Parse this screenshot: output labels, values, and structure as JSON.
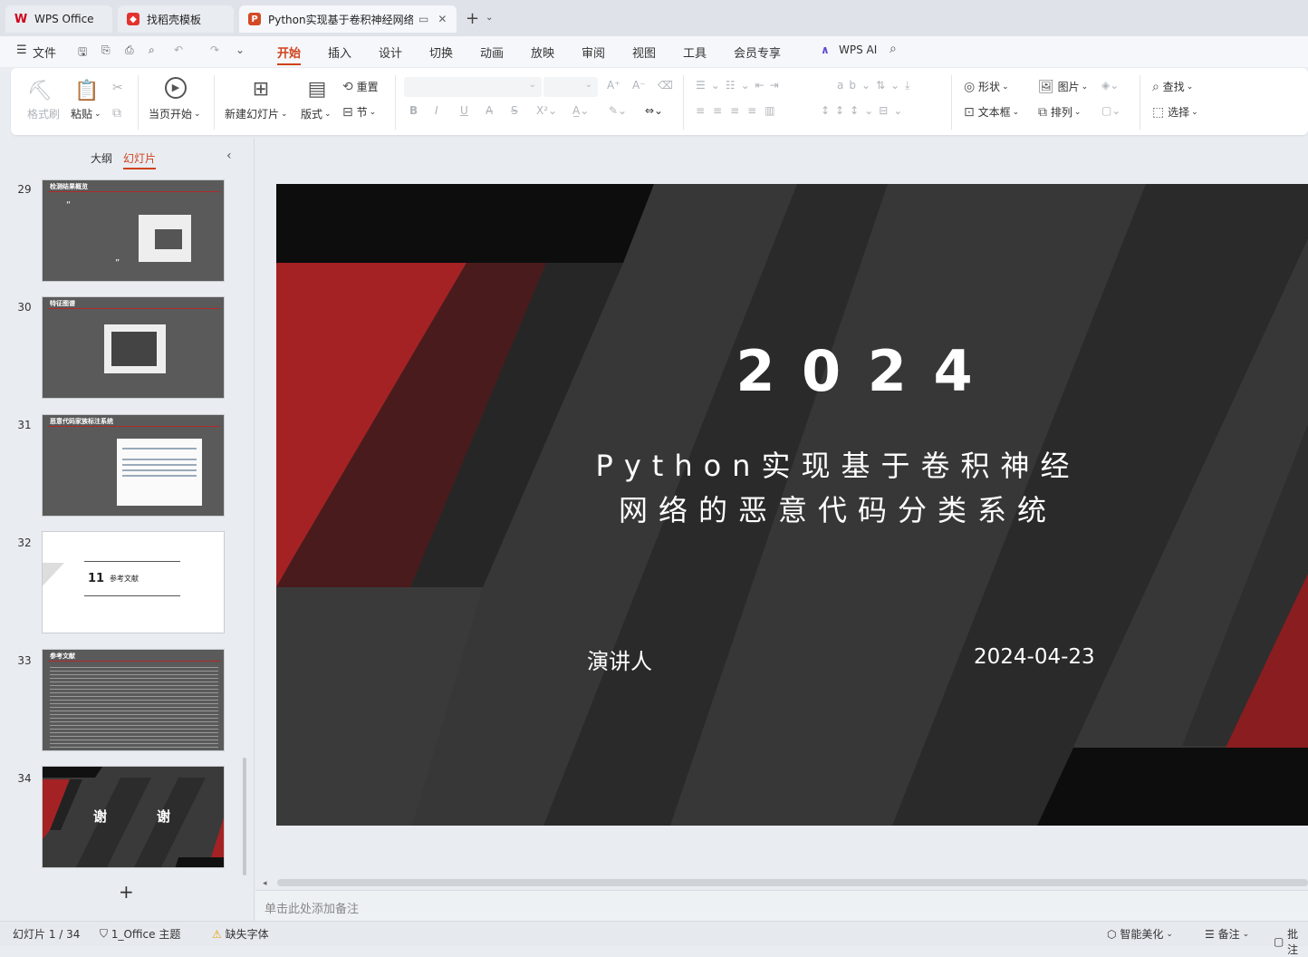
{
  "tabs": [
    {
      "label": "WPS Office"
    },
    {
      "label": "找稻壳模板"
    },
    {
      "label": "Python实现基于卷积神经网络"
    }
  ],
  "menu": [
    "文件",
    "开始",
    "插入",
    "设计",
    "切换",
    "动画",
    "放映",
    "审阅",
    "视图",
    "工具",
    "会员专享",
    "WPS AI"
  ],
  "ribbon": {
    "format_painter": "格式刷",
    "paste": "粘贴",
    "from_current": "当页开始",
    "new_slide": "新建幻灯片",
    "layout": "版式",
    "section": "节",
    "reset": "重置",
    "shape": "形状",
    "picture": "图片",
    "textbox": "文本框",
    "arrange": "排列",
    "find": "查找",
    "select": "选择"
  },
  "sidebar": {
    "outline": "大纲",
    "slides": "幻灯片",
    "thumbs": [
      {
        "num": "29",
        "title": "检测结果概览"
      },
      {
        "num": "30",
        "title": "特征图谱"
      },
      {
        "num": "31",
        "title": "恶意代码家族标注系统"
      },
      {
        "num": "32",
        "num_label": "11",
        "title": "参考文献"
      },
      {
        "num": "33",
        "title": "参考文献"
      },
      {
        "num": "34",
        "thanks_left": "谢",
        "thanks_right": "谢"
      }
    ]
  },
  "slide": {
    "year": "2 0 2 4",
    "title_line1": "Python实现基于卷积神经",
    "title_line2": "网络的恶意代码分类系统",
    "presenter": "演讲人",
    "date": "2024-04-23"
  },
  "notes_placeholder": "单击此处添加备注",
  "status": {
    "slide_counter": "幻灯片 1 / 34",
    "theme": "1_Office 主题",
    "missing_font": "缺失字体",
    "beautify": "智能美化",
    "notes": "备注",
    "comments": "批注"
  },
  "colors": {
    "accent": "#d0421b",
    "slide_red": "#a52224",
    "slide_dark": "#333333"
  }
}
